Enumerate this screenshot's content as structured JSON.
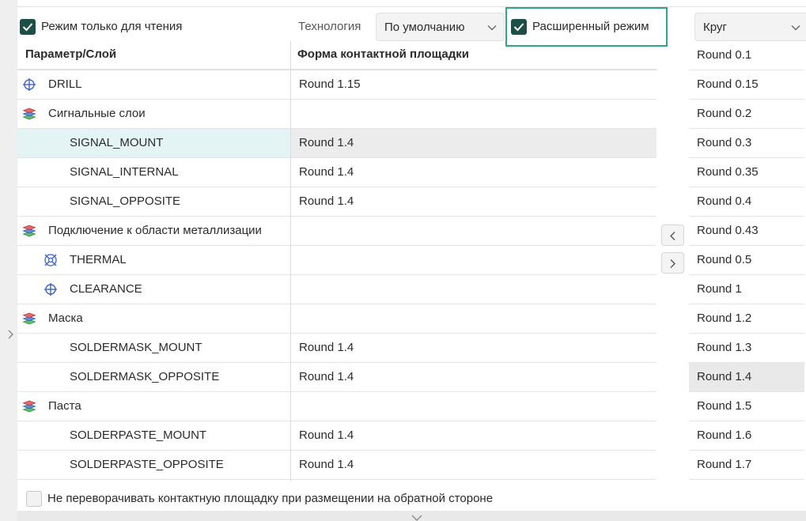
{
  "toolbar": {
    "readonly_checked": true,
    "readonly_label": "Режим только для чтения",
    "technology_label": "Технология",
    "technology_value": "По умолчанию",
    "extended_checked": true,
    "extended_label": "Расширенный режим",
    "shape_value": "Круг"
  },
  "table": {
    "header_param": "Параметр/Слой",
    "header_shape": "Форма контактной площадки",
    "rows": [
      {
        "name": "DRILL",
        "value": "Round 1.15",
        "icon": "crosshair-icon"
      },
      {
        "name": "Сигнальные слои",
        "value": "",
        "icon": "layers-icon"
      },
      {
        "name": "SIGNAL_MOUNT",
        "value": "Round 1.4",
        "icon": "",
        "selected": true
      },
      {
        "name": "SIGNAL_INTERNAL",
        "value": "Round 1.4",
        "icon": ""
      },
      {
        "name": "SIGNAL_OPPOSITE",
        "value": "Round 1.4",
        "icon": ""
      },
      {
        "name": "Подключение к области металлизации",
        "value": "",
        "icon": "layers-icon"
      },
      {
        "name": "THERMAL",
        "value": "",
        "icon": "thermal-icon"
      },
      {
        "name": "CLEARANCE",
        "value": "",
        "icon": "crosshair-icon"
      },
      {
        "name": "Маска",
        "value": "",
        "icon": "layers-icon"
      },
      {
        "name": "SOLDERMASK_MOUNT",
        "value": "Round 1.4",
        "icon": ""
      },
      {
        "name": "SOLDERMASK_OPPOSITE",
        "value": "Round 1.4",
        "icon": ""
      },
      {
        "name": "Паста",
        "value": "",
        "icon": "layers-icon"
      },
      {
        "name": "SOLDERPASTE_MOUNT",
        "value": "Round 1.4",
        "icon": ""
      },
      {
        "name": "SOLDERPASTE_OPPOSITE",
        "value": "Round 1.4",
        "icon": ""
      }
    ]
  },
  "shape_list": [
    "Round 0.1",
    "Round 0.15",
    "Round 0.2",
    "Round 0.3",
    "Round 0.35",
    "Round 0.4",
    "Round 0.43",
    "Round 0.5",
    "Round 1",
    "Round 1.2",
    "Round 1.3",
    "Round 1.4",
    "Round 1.5",
    "Round 1.6",
    "Round 1.7"
  ],
  "shape_list_selected": "Round 1.4",
  "footer": {
    "no_flip_checked": false,
    "no_flip_label": "Не переворачивать контактную площадку при размещении на обратной стороне"
  },
  "colors": {
    "accent": "#1b4f48",
    "highlight_border": "#2fa58c",
    "selected_row": "#e4f4f4",
    "icon_blue": "#3d63c9"
  }
}
